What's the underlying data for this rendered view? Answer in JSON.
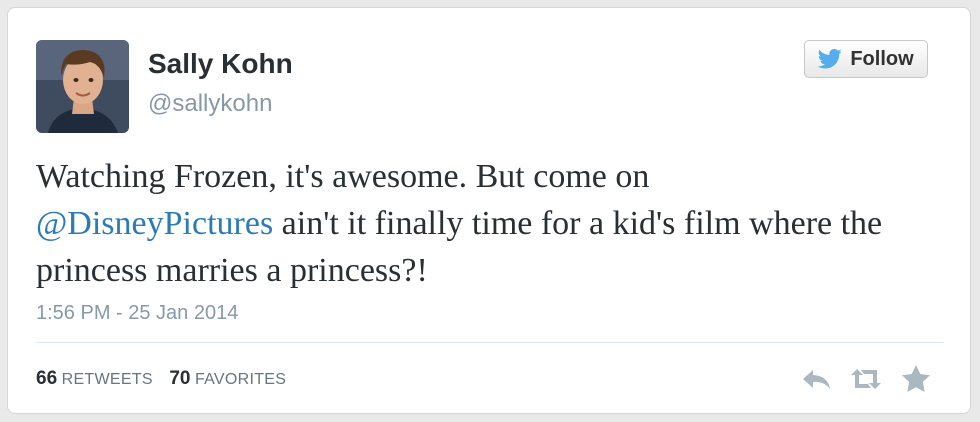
{
  "user": {
    "name": "Sally Kohn",
    "handle": "@sallykohn"
  },
  "follow_button": {
    "label": "Follow",
    "icon": "bird-icon"
  },
  "tweet": {
    "text_before": "Watching Frozen, it's awesome. But come on",
    "mention": "@DisneyPictures",
    "text_after": "ain't it finally time for a kid's film where the princess marries a princess?!",
    "timestamp": "1:56 PM - 25 Jan 2014"
  },
  "stats": {
    "retweets_count": "66",
    "retweets_label": "RETWEETS",
    "favorites_count": "70",
    "favorites_label": "FAVORITES"
  },
  "actions": [
    "reply-icon",
    "retweet-icon",
    "favorite-star-icon"
  ],
  "colors": {
    "link": "#2b7bb9",
    "twitter_blue": "#55acee",
    "muted": "#8899a6",
    "action_icons": "#aab8c2"
  }
}
